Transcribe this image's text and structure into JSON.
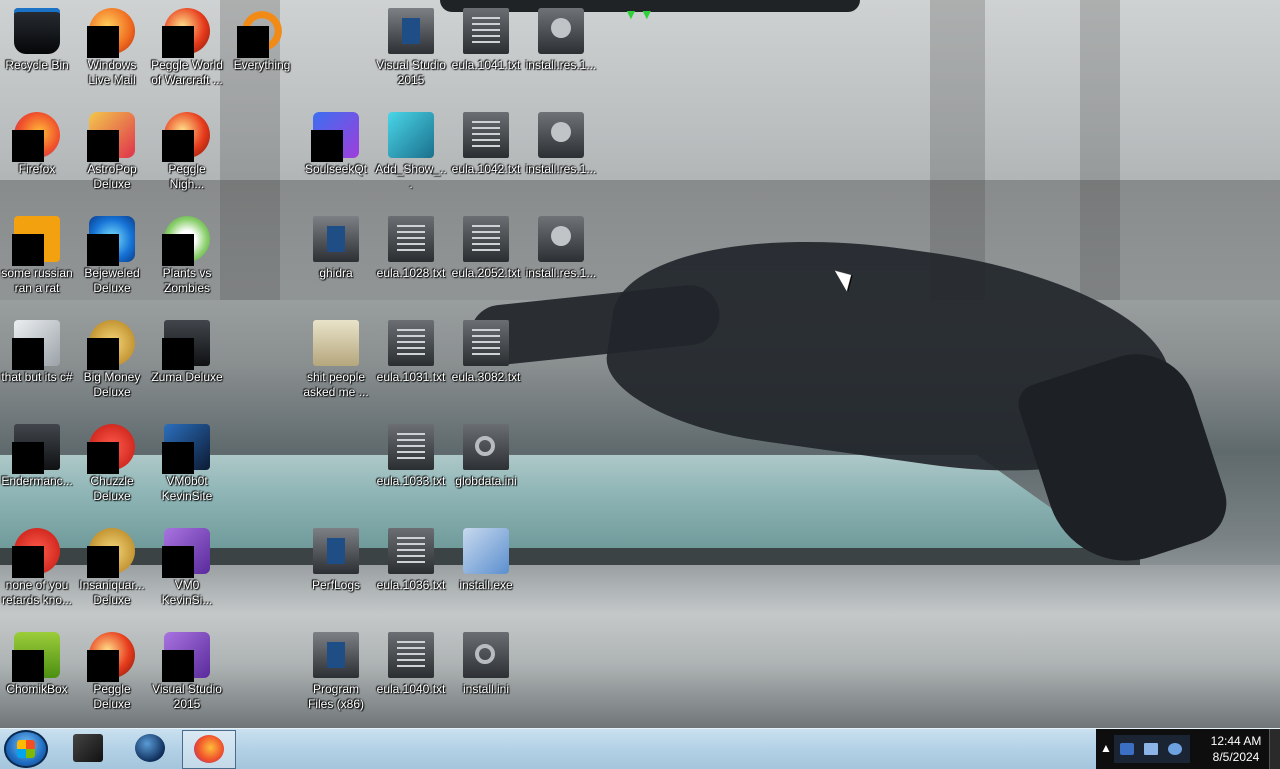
{
  "desktop": {
    "icons": [
      {
        "label": "Recycle Bin",
        "icon": "recycle-bin-icon"
      },
      {
        "label": "Windows Live Mail",
        "icon": "mail-icon"
      },
      {
        "label": "Peggle World of Warcraft ...",
        "icon": "peggle-wow-icon"
      },
      {
        "label": "Everything",
        "icon": "everything-icon"
      },
      {
        "label": "Visual Studio 2015",
        "icon": "visual-studio-shortcut-icon"
      },
      {
        "label": "eula.1041.txt",
        "icon": "text-file-icon"
      },
      {
        "label": "install.res.1...",
        "icon": "resource-file-icon"
      },
      {
        "label": "Firefox",
        "icon": "firefox-icon"
      },
      {
        "label": "AstroPop Deluxe",
        "icon": "astropop-icon"
      },
      {
        "label": "Peggle Nigh...",
        "icon": "peggle-nights-icon"
      },
      {
        "label": "SoulseekQt",
        "icon": "soulseek-icon"
      },
      {
        "label": "Add_Show_...",
        "icon": "registry-file-icon"
      },
      {
        "label": "eula.1042.txt",
        "icon": "text-file-icon"
      },
      {
        "label": "install.res.1...",
        "icon": "resource-file-icon"
      },
      {
        "label": "some russian ran a rat",
        "icon": "rat-app-icon"
      },
      {
        "label": "Bejeweled Deluxe",
        "icon": "bejeweled-icon"
      },
      {
        "label": "Plants vs Zombies",
        "icon": "plants-vs-zombies-icon"
      },
      {
        "label": "ghidra",
        "icon": "folder-icon"
      },
      {
        "label": "eula.1028.txt",
        "icon": "text-file-icon"
      },
      {
        "label": "eula.2052.txt",
        "icon": "text-file-icon"
      },
      {
        "label": "install.res.1...",
        "icon": "resource-file-icon"
      },
      {
        "label": "that but its c#",
        "icon": "stacked-windows-icon"
      },
      {
        "label": "Big Money Deluxe",
        "icon": "big-money-icon"
      },
      {
        "label": "Zuma Deluxe",
        "icon": "zuma-icon"
      },
      {
        "label": "shit people asked me ...",
        "icon": "folder-icon"
      },
      {
        "label": "eula.1031.txt",
        "icon": "text-file-icon"
      },
      {
        "label": "eula.3082.txt",
        "icon": "text-file-icon"
      },
      {
        "label": "Endermanc...",
        "icon": "terminal-icon"
      },
      {
        "label": "Chuzzle Deluxe",
        "icon": "chuzzle-icon"
      },
      {
        "label": "VM0b0t KevinSite",
        "icon": "vm-ship-icon"
      },
      {
        "label": "eula.1033.txt",
        "icon": "text-file-icon"
      },
      {
        "label": "globdata.ini",
        "icon": "config-file-icon"
      },
      {
        "label": "none of you retards kno...",
        "icon": "red-ball-icon"
      },
      {
        "label": "Insaniquar... Deluxe",
        "icon": "insaniquarium-icon"
      },
      {
        "label": "VM0 KevinSi...",
        "icon": "vm-purple-icon"
      },
      {
        "label": "PerfLogs",
        "icon": "folder-icon"
      },
      {
        "label": "eula.1036.txt",
        "icon": "text-file-icon"
      },
      {
        "label": "install.exe",
        "icon": "installer-icon"
      },
      {
        "label": "ChomikBox",
        "icon": "chomikbox-icon"
      },
      {
        "label": "Peggle Deluxe",
        "icon": "peggle-icon"
      },
      {
        "label": "Visual Studio 2015",
        "icon": "visual-studio-icon"
      },
      {
        "label": "Program Files (x86)",
        "icon": "folder-icon"
      },
      {
        "label": "eula.1040.txt",
        "icon": "text-file-icon"
      },
      {
        "label": "install.ini",
        "icon": "config-file-icon"
      }
    ]
  },
  "taskbar": {
    "start": {
      "icon": "windows-start-icon"
    },
    "pinned": [
      {
        "icon": "black-cube-app-icon"
      },
      {
        "icon": "globe-app-icon"
      },
      {
        "icon": "firefox-icon",
        "active": true
      }
    ],
    "tray": {
      "chevron": "▲",
      "clock_time": "12:44 AM",
      "clock_date": "8/5/2024"
    }
  },
  "colors": {
    "taskbar": "#b3d1e6",
    "tray": "#0e0e0e",
    "label_text": "#ffffff"
  }
}
